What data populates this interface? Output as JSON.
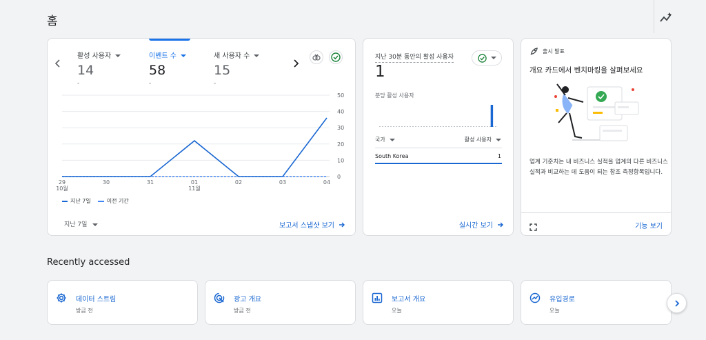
{
  "header": {
    "title": "홈",
    "insights_icon": "insights-sparkline-icon"
  },
  "overview_card": {
    "metrics": [
      {
        "label": "활성 사용자",
        "value": "14",
        "sub": "-",
        "active": false
      },
      {
        "label": "이벤트 수",
        "value": "58",
        "sub": "-",
        "active": true
      },
      {
        "label": "새 사용자 수",
        "value": "15",
        "sub": "-",
        "active": false
      }
    ],
    "y_ticks": [
      "50",
      "40",
      "30",
      "20",
      "10",
      "0"
    ],
    "x_ticks": [
      {
        "day": "29",
        "month": "10월"
      },
      {
        "day": "30",
        "month": ""
      },
      {
        "day": "31",
        "month": ""
      },
      {
        "day": "01",
        "month": "11월"
      },
      {
        "day": "02",
        "month": ""
      },
      {
        "day": "03",
        "month": ""
      },
      {
        "day": "04",
        "month": ""
      }
    ],
    "legend": {
      "current": "지난 7일",
      "previous": "이전 기간"
    },
    "date_range": "지난 7일",
    "snapshot_link": "보고서 스냅샷 보기"
  },
  "chart_data": {
    "type": "line",
    "x": [
      "10월 29",
      "30",
      "31",
      "11월 01",
      "02",
      "03",
      "04"
    ],
    "series": [
      {
        "name": "지난 7일",
        "values": [
          0,
          0,
          0,
          22,
          0,
          0,
          36
        ],
        "color": "#1967d2"
      },
      {
        "name": "이전 기간",
        "values": [
          0,
          0,
          0,
          0,
          0,
          0,
          0
        ],
        "color": "#4285f4"
      }
    ],
    "ylim": [
      0,
      50
    ],
    "grid": true,
    "legend_position": "bottom-left"
  },
  "realtime_card": {
    "title": "지난 30분 동안의 활성 사용자",
    "value": "1",
    "subtitle": "분당 활성 사용자",
    "bar_values": [
      0,
      0,
      0,
      0,
      0,
      0,
      0,
      0,
      0,
      0,
      0,
      0,
      0,
      0,
      0,
      0,
      0,
      0,
      0,
      0,
      0,
      0,
      0,
      0,
      0,
      0,
      0,
      0,
      1,
      0
    ],
    "col_country": "국가",
    "col_users": "활성 사용자",
    "rows": [
      {
        "country": "South Korea",
        "users": "1"
      }
    ],
    "link": "실시간 보기"
  },
  "launch_card": {
    "tag": "출시 발표",
    "title": "개요 카드에서 벤치마킹을 살펴보세요",
    "body": "업계 기준치는 내 비즈니스 실적을 업계의 다른 비즈니스 실적과 비교하는 데 도움이 되는 참조 측정항목입니다.",
    "link": "기능 보기"
  },
  "recent": {
    "title": "Recently accessed",
    "items": [
      {
        "label": "데이터 스트림",
        "sub": "방금 전",
        "icon": "gear-icon"
      },
      {
        "label": "광고 개요",
        "sub": "방금 전",
        "icon": "ads-target-icon"
      },
      {
        "label": "보고서 개요",
        "sub": "오늘",
        "icon": "report-chart-icon"
      },
      {
        "label": "유입경로",
        "sub": "오늘",
        "icon": "funnel-trend-icon"
      }
    ]
  }
}
